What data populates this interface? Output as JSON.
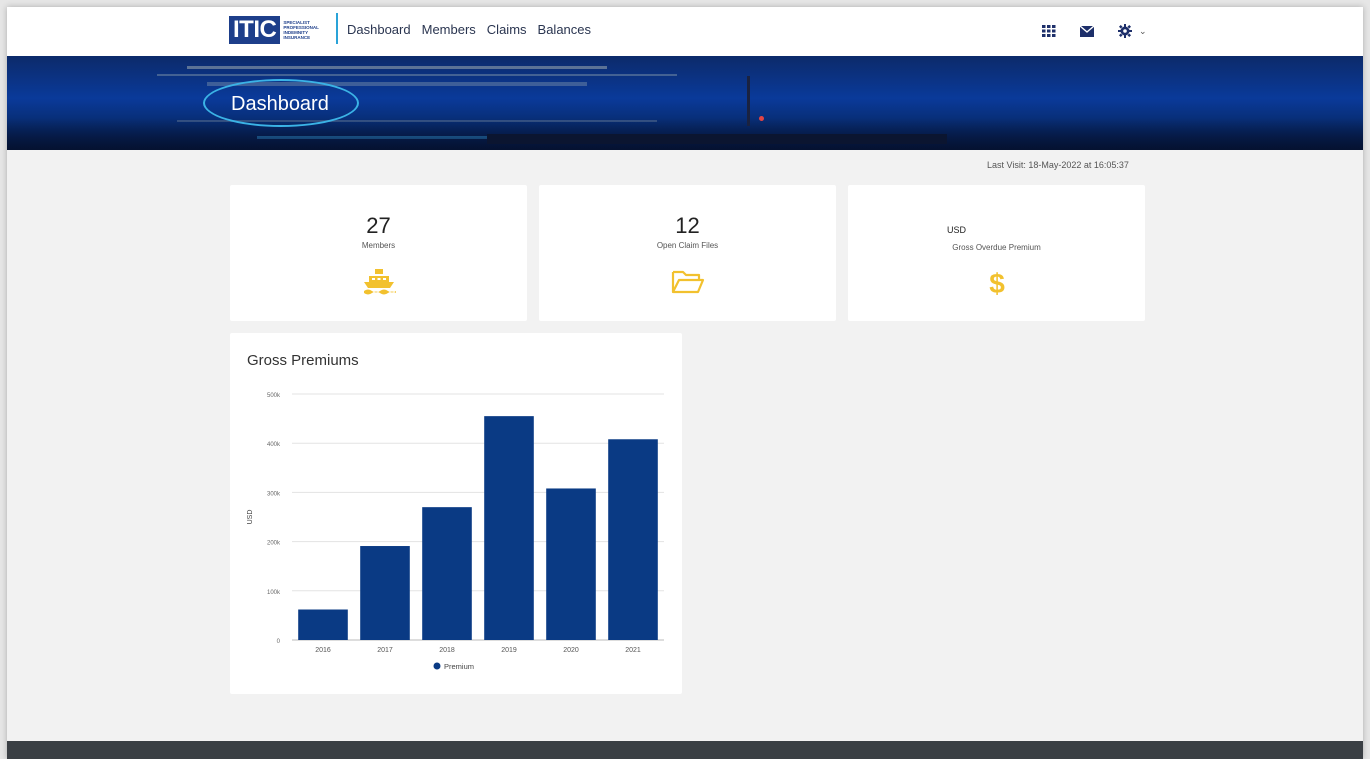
{
  "brand": {
    "logo_text": "ITIC",
    "logo_sub": [
      "Specialist",
      "Professional",
      "Indemnity",
      "Insurance"
    ],
    "accent": "#1d3e8a",
    "divider": "#2aa3d8"
  },
  "nav": {
    "links": [
      "Dashboard",
      "Members",
      "Claims",
      "Balances"
    ],
    "icons": [
      "grid-icon",
      "mail-icon",
      "gear-icon"
    ]
  },
  "hero": {
    "title": "Dashboard"
  },
  "last_visit": "Last Visit: 18-May-2022 at 16:05:37",
  "stats": [
    {
      "value": "27",
      "label": "Members",
      "icon": "ship-icon"
    },
    {
      "value": "12",
      "label": "Open Claim Files",
      "icon": "folder-icon"
    },
    {
      "value": "USD",
      "label": "Gross Overdue Premium",
      "icon": "dollar-icon"
    }
  ],
  "icon_color": "#f2c12e",
  "chart_data": {
    "type": "bar",
    "title": "Gross Premiums",
    "ylabel": "USD",
    "xlabel": "",
    "categories": [
      "2016",
      "2017",
      "2018",
      "2019",
      "2020",
      "2021"
    ],
    "series": [
      {
        "name": "Premium",
        "values": [
          62000,
          191000,
          270000,
          455000,
          308000,
          408000
        ],
        "color": "#0a3a84"
      }
    ],
    "ylim": [
      0,
      500000
    ],
    "yticks": [
      "0",
      "100k",
      "200k",
      "300k",
      "400k",
      "500k"
    ],
    "grid": true,
    "legend": "bottom"
  }
}
